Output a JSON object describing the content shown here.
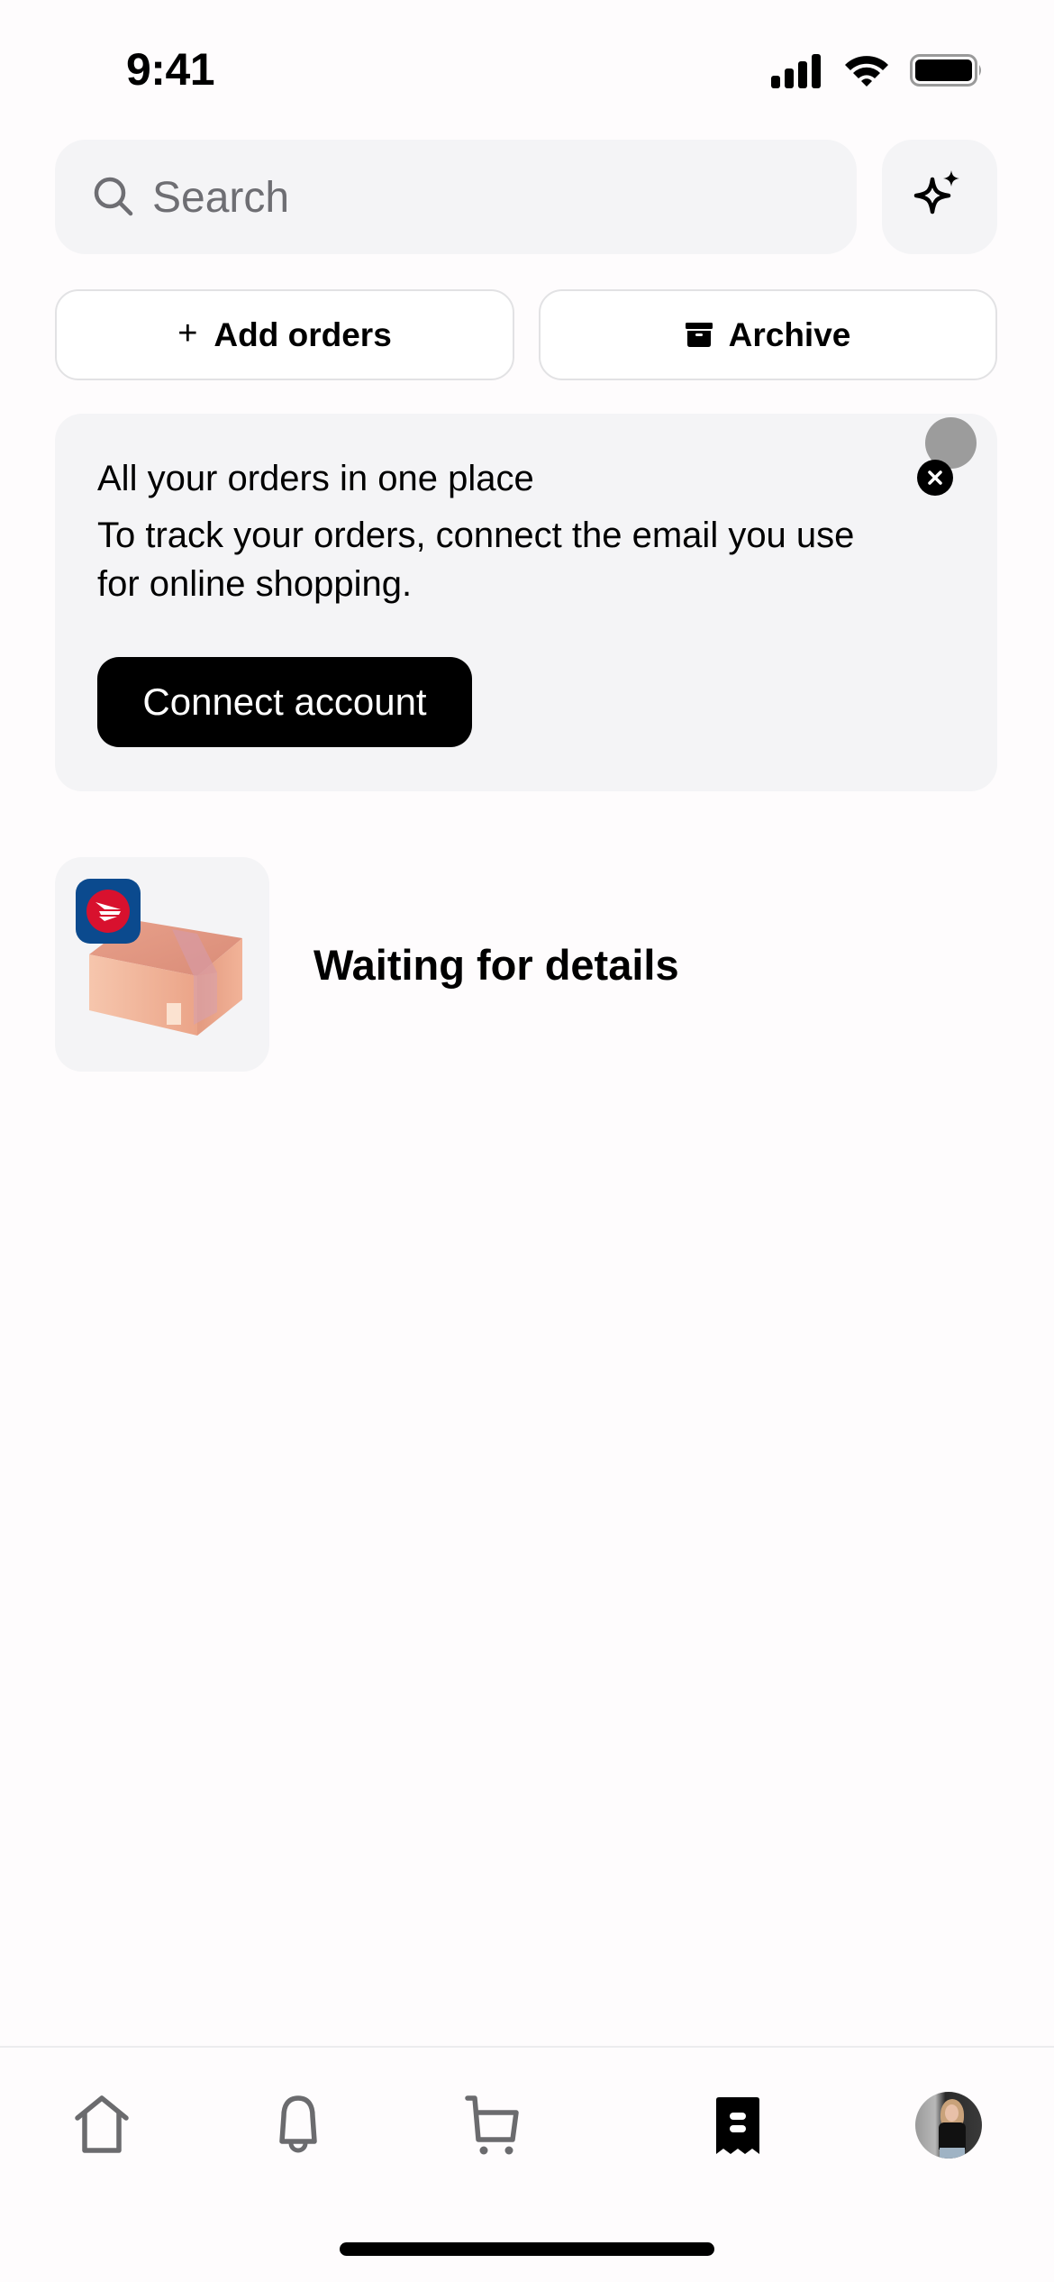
{
  "status_bar": {
    "time": "9:41",
    "icons": [
      "cellular-signal-icon",
      "wifi-icon",
      "battery-icon"
    ]
  },
  "search": {
    "placeholder": "Search",
    "icon": "search-icon",
    "ai_button_icon": "sparkles-icon"
  },
  "actions": {
    "add_orders": {
      "label": "Add orders",
      "icon": "plus-icon"
    },
    "archive": {
      "label": "Archive",
      "icon": "archive-box-icon"
    }
  },
  "promo_card": {
    "title": "All your orders in one place",
    "body": "To track your orders, connect the email you use for online shopping.",
    "button_label": "Connect account",
    "close_icon": "close-icon"
  },
  "orders": [
    {
      "status": "Waiting for details",
      "carrier_icon": "canada-post-logo",
      "thumbnail": "package-box-illustration"
    }
  ],
  "tab_bar": {
    "items": [
      {
        "name": "home",
        "icon": "home-icon",
        "active": false
      },
      {
        "name": "notifications",
        "icon": "bell-icon",
        "active": false
      },
      {
        "name": "cart",
        "icon": "cart-icon",
        "active": false
      },
      {
        "name": "orders",
        "icon": "receipt-icon",
        "active": true
      },
      {
        "name": "profile",
        "icon": "avatar",
        "active": false
      }
    ]
  },
  "colors": {
    "background": "#fefcfd",
    "card": "#f4f4f6",
    "primary": "#000000",
    "muted_icon": "#6b6b6e",
    "carrier_blue": "#0b4a8e",
    "carrier_red": "#d8112e"
  }
}
